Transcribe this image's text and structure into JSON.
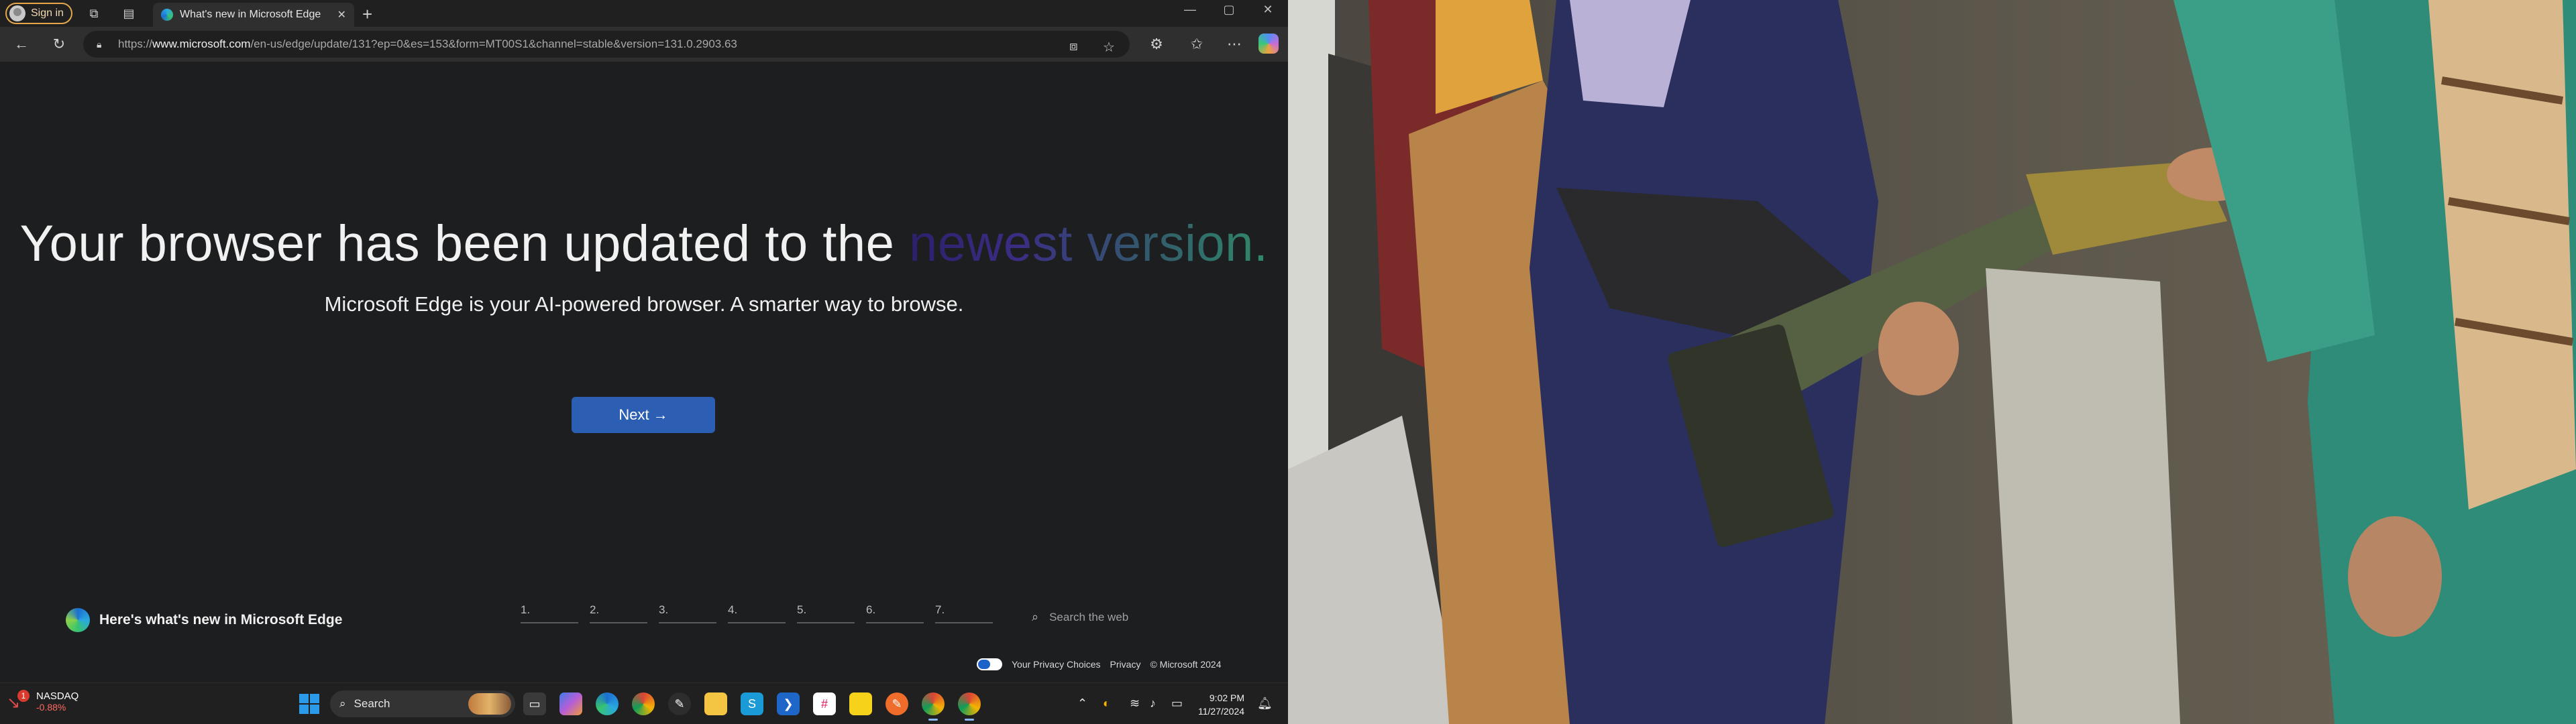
{
  "browser": {
    "signin_label": "Sign in",
    "tab_title": "What's new in Microsoft Edge",
    "url_prefix": "https://",
    "url_domain": "www.microsoft.com",
    "url_path": "/en-us/edge/update/131?ep=0&es=153&form=MT00S1&channel=stable&version=131.0.2903.63"
  },
  "page": {
    "headline_main": "Your browser has been updated to the ",
    "headline_fade": "newest version.",
    "subhead": "Microsoft Edge is your AI-powered browser. A smarter way to browse.",
    "next_label": "Next",
    "next_arrow": "→",
    "whatsnew_label": "Here's what's new in Microsoft Edge",
    "steps": [
      "1.",
      "2.",
      "3.",
      "4.",
      "5.",
      "6.",
      "7."
    ],
    "search_placeholder": "Search the web",
    "footer": {
      "privacy_choices": "Your Privacy Choices",
      "privacy": "Privacy",
      "copyright": "© Microsoft 2024"
    }
  },
  "taskbar": {
    "stock_badge": "1",
    "stock_name": "NASDAQ",
    "stock_change": "-0.88%",
    "search_label": "Search",
    "time": "9:02 PM",
    "date": "11/27/2024"
  },
  "icons": [
    "profile-avatar-icon",
    "workspaces-icon",
    "tab-actions-icon",
    "edge-favicon-icon",
    "close-tab-icon",
    "new-tab-icon",
    "minimize-icon",
    "maximize-icon",
    "close-window-icon",
    "back-icon",
    "refresh-icon",
    "lock-icon",
    "app-available-icon",
    "favorite-star-icon",
    "extensions-icon",
    "favorites-icon",
    "more-icon",
    "copilot-icon",
    "edge-logo-icon",
    "search-icon",
    "windows-start-icon"
  ],
  "colors": {
    "page_bg": "#1d1e20",
    "next_button": "#2c5fb3",
    "signin_border": "#e6a74b",
    "stock_negative": "#ff6b61"
  }
}
